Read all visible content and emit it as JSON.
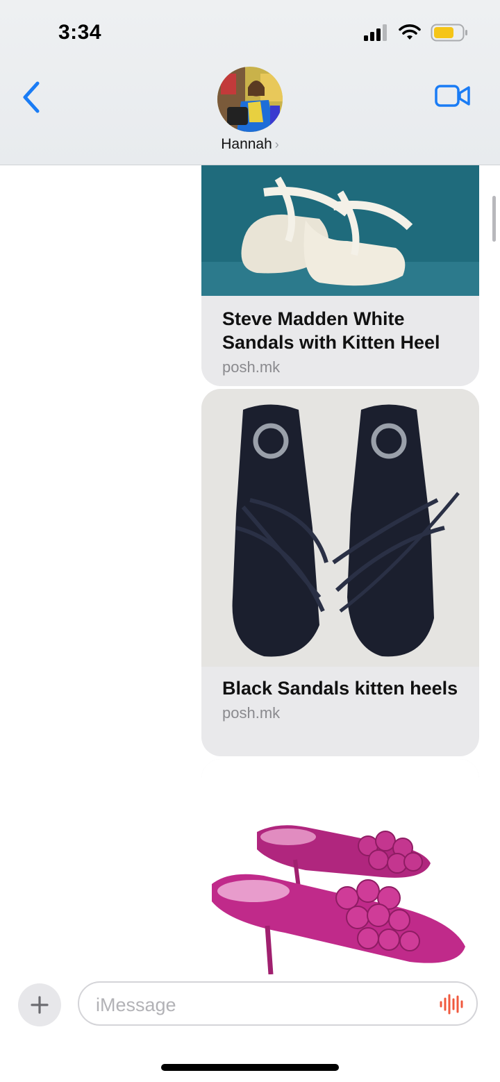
{
  "status_bar": {
    "time": "3:34",
    "battery_color": "#f5c518"
  },
  "header": {
    "contact_name": "Hannah",
    "back_icon": "chevron-left-icon",
    "video_icon": "video-camera-icon",
    "accent_color": "#1a7cf5"
  },
  "messages": [
    {
      "title": "Steve Madden White Sandals with Kitten Heel",
      "domain": "posh.mk",
      "image": "white-sandals-photo"
    },
    {
      "title": "Black Sandals kitten heels",
      "domain": "posh.mk",
      "image": "black-sandals-photo"
    },
    {
      "title": "",
      "domain": "",
      "image": "pink-coach-heels-photo"
    }
  ],
  "input_bar": {
    "placeholder": "iMessage",
    "plus_icon": "plus-icon",
    "audio_icon": "audio-waveform-icon"
  }
}
